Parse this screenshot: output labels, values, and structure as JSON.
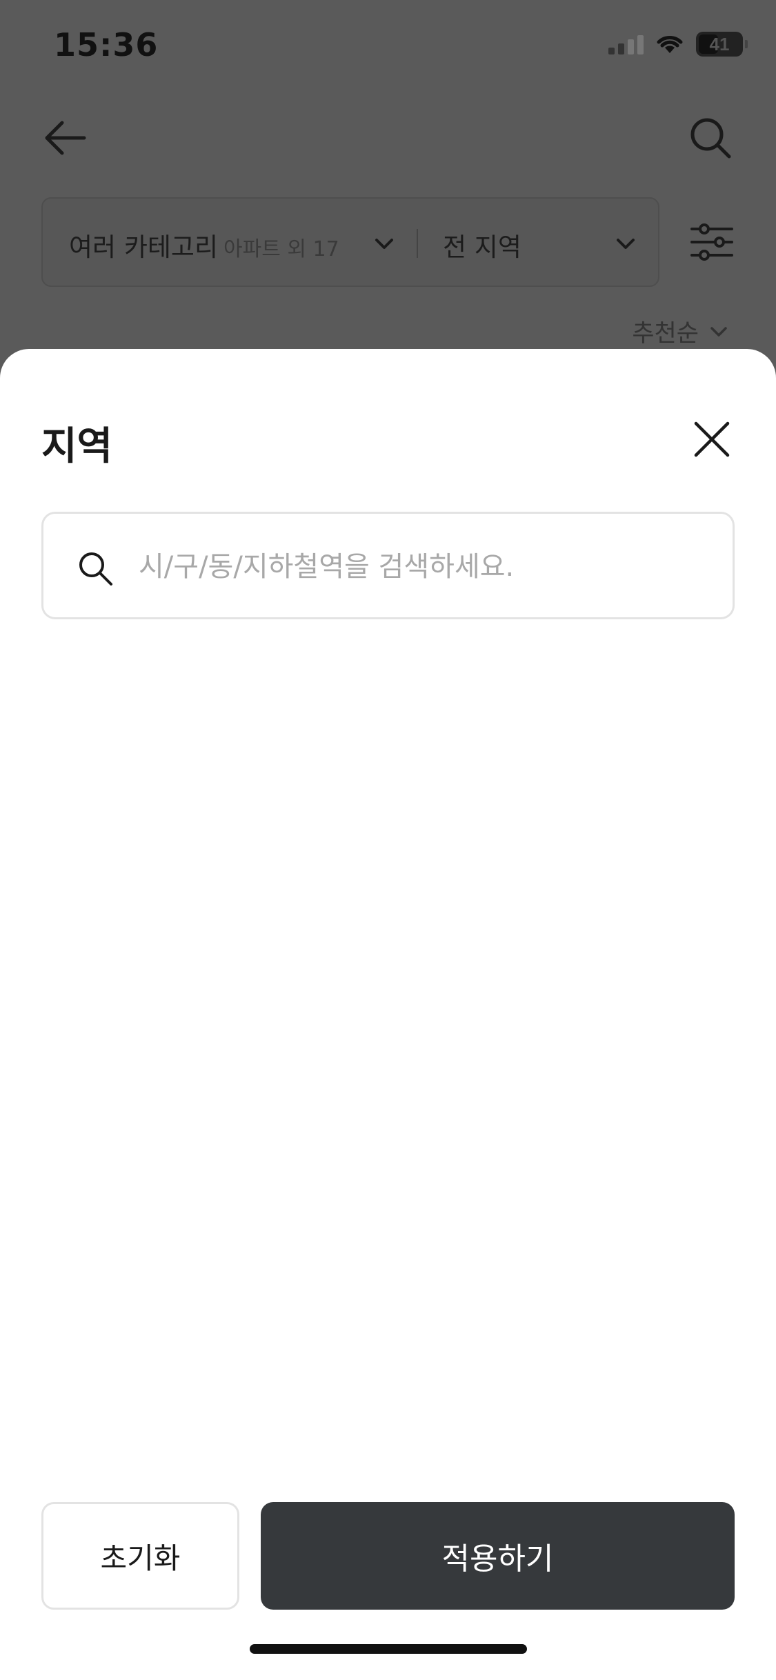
{
  "status_bar": {
    "time": "15:36",
    "battery": "41",
    "icons": [
      "cellular-signal-icon",
      "wifi-icon",
      "battery-icon"
    ]
  },
  "background_page": {
    "back_icon": "arrow-left-icon",
    "search_icon": "search-icon",
    "filter": {
      "category_label": "여러 카테고리",
      "category_sub": "아파트  외 17",
      "region_label": "전 지역"
    },
    "settings_icon": "sliders-icon",
    "sort_label": "추천순"
  },
  "sheet": {
    "title": "지역",
    "close_icon": "close-icon",
    "search": {
      "placeholder": "시/구/동/지하철역을 검색하세요.",
      "value": ""
    },
    "reset_label": "초기화",
    "apply_label": "적용하기"
  },
  "colors": {
    "overlay": "#5a5a5a",
    "sheet_bg": "#ffffff",
    "apply_bg": "#36393c",
    "border": "#e3e3e3",
    "placeholder": "#a8a8a8"
  }
}
